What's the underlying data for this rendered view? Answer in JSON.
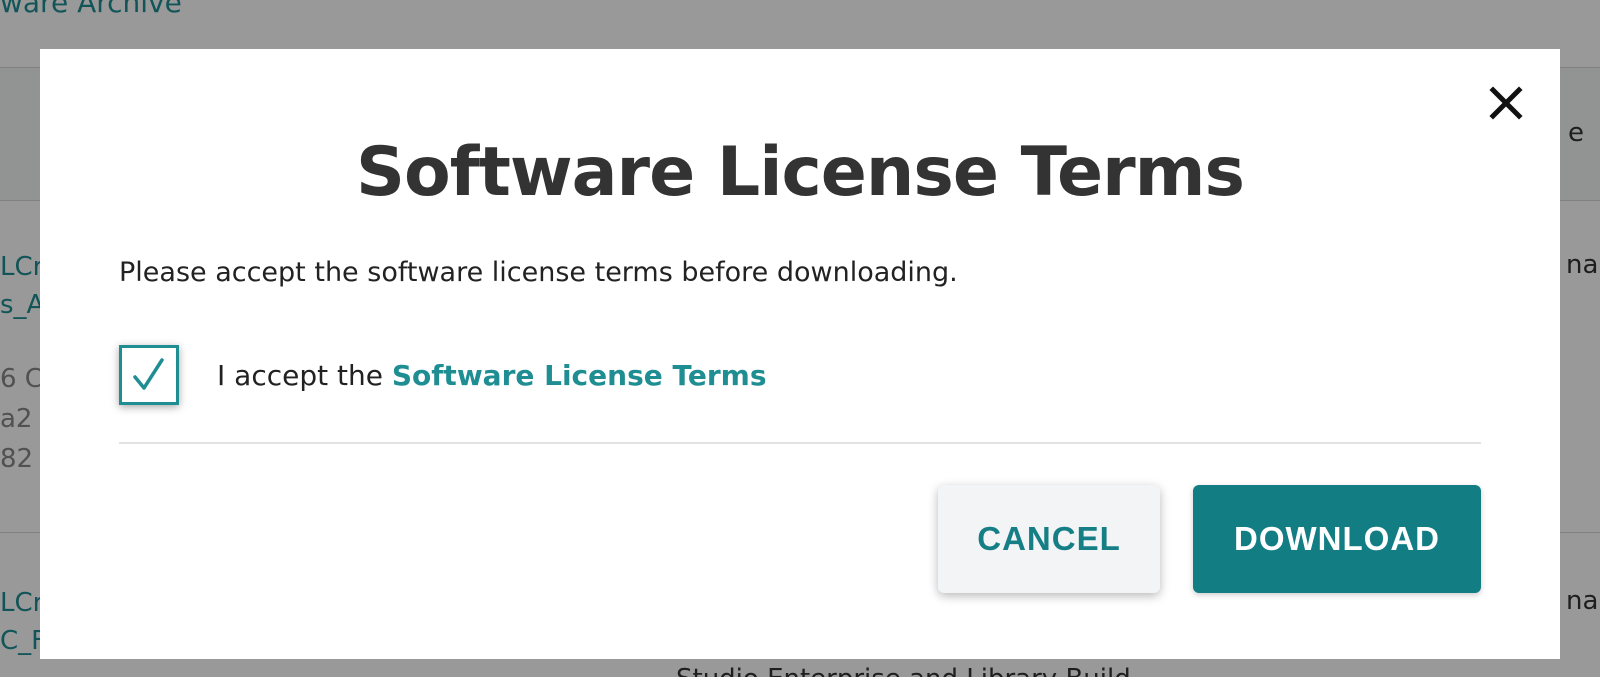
{
  "background": {
    "top_title_fragment": "ware Archive",
    "header_right_fragment": "e",
    "row1": {
      "name_line1_fragment": "LCr",
      "name_line2_fragment": "s_A",
      "meta_line1_fragment": "6 C",
      "meta_line2_fragment": "a2",
      "meta_line3_fragment": "82",
      "right_fragment": "na"
    },
    "row2": {
      "name_line1_fragment": "LCr",
      "name_line2_fragment": "C_F",
      "right_fragment": "na",
      "bottom_fragment": "Studio Enterprise and Library Build"
    }
  },
  "modal": {
    "title": "Software License Terms",
    "message": "Please accept the software license terms before downloading.",
    "checkbox": {
      "checked": true,
      "label_prefix": "I accept the ",
      "link_text": "Software License Terms"
    },
    "buttons": {
      "cancel_label": "CANCEL",
      "download_label": "DOWNLOAD"
    }
  },
  "colors": {
    "accent": "#1f8e93",
    "primary_button": "#137d84",
    "title_text": "#333333"
  },
  "icons": {
    "close": "close-icon",
    "check": "checkmark-icon"
  }
}
